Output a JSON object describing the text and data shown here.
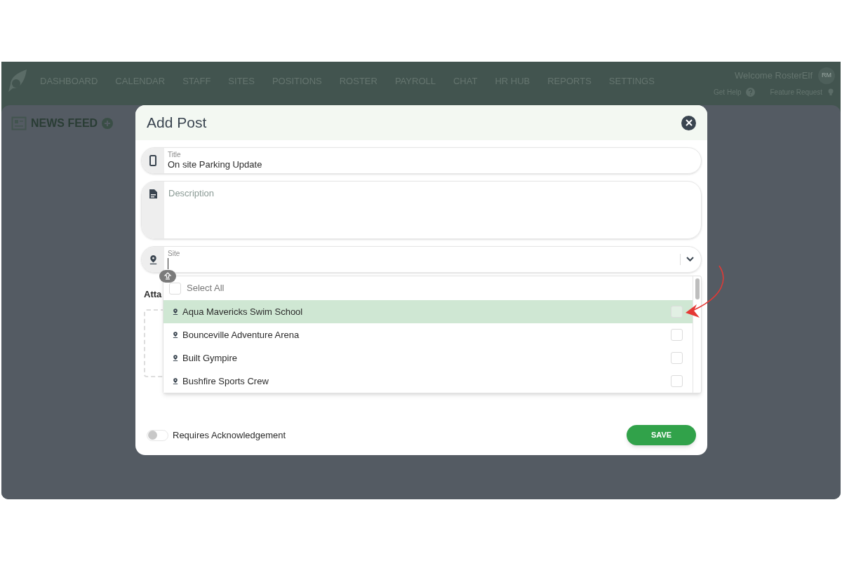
{
  "nav": {
    "items": [
      {
        "label": "DASHBOARD"
      },
      {
        "label": "CALENDAR"
      },
      {
        "label": "STAFF"
      },
      {
        "label": "SITES"
      },
      {
        "label": "POSITIONS"
      },
      {
        "label": "ROSTER"
      },
      {
        "label": "PAYROLL"
      },
      {
        "label": "CHAT"
      },
      {
        "label": "HR HUB"
      },
      {
        "label": "REPORTS"
      },
      {
        "label": "SETTINGS"
      }
    ],
    "welcome": "Welcome RosterElf",
    "avatar": "RM",
    "help": "Get Help",
    "feature": "Feature Request"
  },
  "page": {
    "title": "NEWS FEED",
    "attachments_label": "Atta"
  },
  "modal": {
    "title": "Add Post",
    "title_field": {
      "label": "Title",
      "value": "On site Parking Update"
    },
    "description_field": {
      "placeholder": "Description"
    },
    "site_field": {
      "label": "Site"
    },
    "select_all": {
      "label": "Select All",
      "checked": false
    },
    "sites": [
      {
        "name": "Aqua Mavericks Swim School",
        "selected": true,
        "checked": false
      },
      {
        "name": "Bounceville Adventure Arena",
        "selected": false,
        "checked": false
      },
      {
        "name": "Built Gympire",
        "selected": false,
        "checked": false
      },
      {
        "name": "Bushfire Sports Crew",
        "selected": false,
        "checked": false
      }
    ],
    "acknowledgement": {
      "label": "Requires Acknowledgement",
      "on": false
    },
    "save": "SAVE"
  }
}
